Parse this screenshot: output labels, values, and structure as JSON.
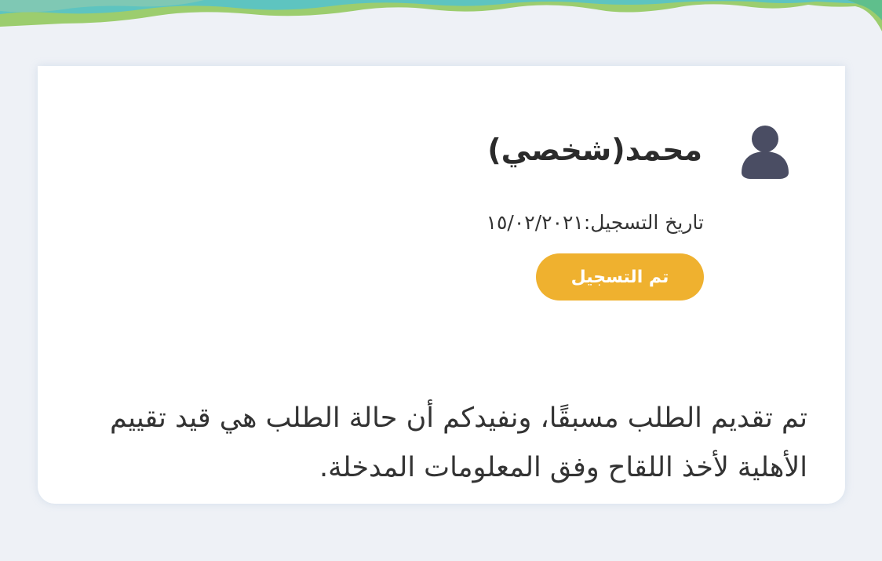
{
  "colors": {
    "page_background": "#eef1f6",
    "card_background": "#ffffff",
    "accent": "#efb12f",
    "avatar": "#4a4d63",
    "text": "#2b2b2b",
    "wave_teal": "#5ec4c0",
    "wave_green": "#9ccd6e"
  },
  "profile": {
    "avatar_icon": "user-icon",
    "name": "محمد(شخصي)",
    "registration_date": "تاريخ التسجيل:١٥/٠٢/٢٠٢١",
    "status_label": "تم التسجيل"
  },
  "message": "تم تقديم الطلب مسبقًا، ونفيدكم أن حالة الطلب هي قيد تقييم الأهلية لأخذ اللقاح وفق المعلومات المدخلة."
}
